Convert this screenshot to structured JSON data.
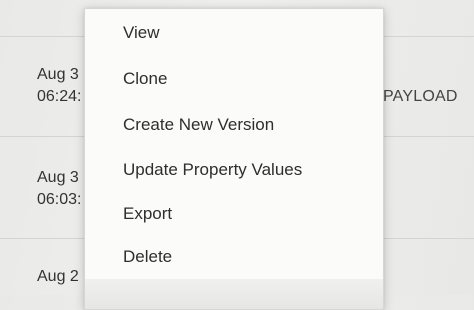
{
  "table": {
    "rows": [
      {
        "date": "Aug 3",
        "time": "06:24:"
      },
      {
        "date": "Aug 3",
        "time": "06:03:"
      },
      {
        "date": "Aug 2",
        "time": ""
      }
    ],
    "type_value": "PAYLOAD"
  },
  "context_menu": {
    "items": [
      {
        "label": "View"
      },
      {
        "label": "Clone"
      },
      {
        "label": "Create New Version"
      },
      {
        "label": "Update Property Values"
      },
      {
        "label": "Export"
      },
      {
        "label": "Delete"
      }
    ]
  }
}
